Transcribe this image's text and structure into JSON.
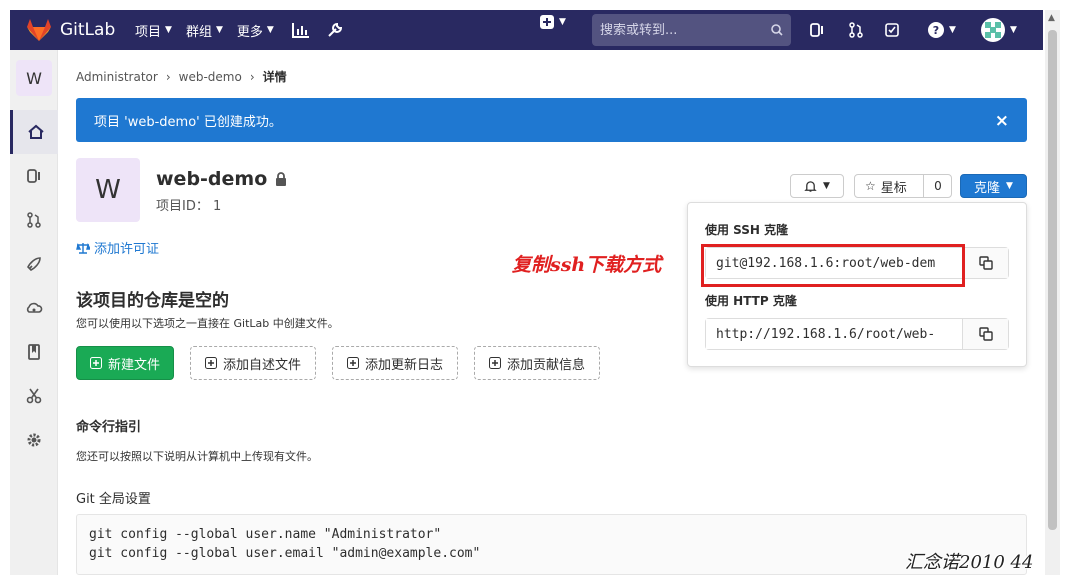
{
  "navbar": {
    "brand": "GitLab",
    "menu": [
      {
        "label": "项目"
      },
      {
        "label": "群组"
      },
      {
        "label": "更多"
      }
    ],
    "search_placeholder": "搜索或转到..."
  },
  "sidebar": {
    "project_initial": "W"
  },
  "breadcrumb": {
    "items": [
      "Administrator",
      "web-demo",
      "详情"
    ]
  },
  "alert": {
    "message": "项目 'web-demo' 已创建成功。",
    "close": "×"
  },
  "project": {
    "initial": "W",
    "name": "web-demo",
    "id_text": "项目ID：  1",
    "star_label": "星标",
    "star_count": "0",
    "clone_label": "克隆",
    "license_label": "添加许可证"
  },
  "empty_repo": {
    "title": "该项目的仓库是空的",
    "subtitle": "您可以使用以下选项之一直接在 GitLab 中创建文件。",
    "buttons": {
      "new_file": "新建文件",
      "readme": "添加自述文件",
      "changelog": "添加更新日志",
      "contributing": "添加贡献信息"
    }
  },
  "cli": {
    "title": "命令行指引",
    "subtitle": "您还可以按照以下说明从计算机中上传现有文件。",
    "git_global_title": "Git 全局设置",
    "code_line1": "git config --global user.name \"Administrator\"",
    "code_line2": "git config --global user.email \"admin@example.com\""
  },
  "clone_dropdown": {
    "ssh_label": "使用 SSH 克隆",
    "ssh_url": "git@192.168.1.6:root/web-dem",
    "http_label": "使用 HTTP 克隆",
    "http_url": "http://192.168.1.6/root/web-"
  },
  "annotation": {
    "text": "复制ssh下载方式",
    "color": "#e02020"
  },
  "watermark": "汇念诺2010 44",
  "colors": {
    "navbar": "#292961",
    "accent": "#1f78d1",
    "success": "#1aaa55"
  }
}
